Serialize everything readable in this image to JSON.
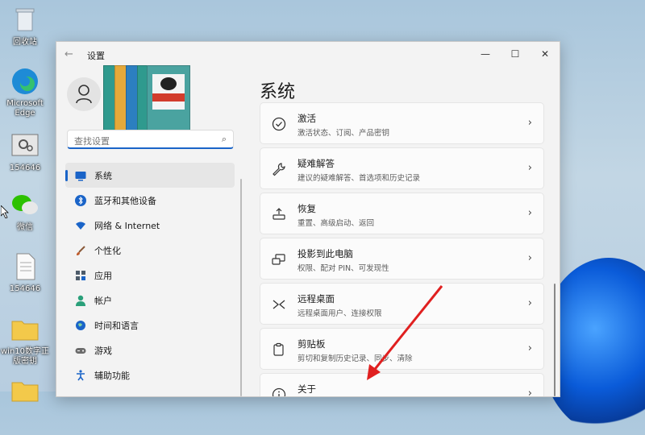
{
  "desktop": {
    "icons": [
      {
        "label": "回收站"
      },
      {
        "label": "Microsoft Edge"
      },
      {
        "label": "154646"
      },
      {
        "label": "微信"
      },
      {
        "label": "154646"
      },
      {
        "label": "win10数字正 版密钥"
      }
    ]
  },
  "window": {
    "title": "设置",
    "back": "←",
    "controls": {
      "minimize": "—",
      "maximize": "☐",
      "close": "✕"
    }
  },
  "sidebar": {
    "search_placeholder": "查找设置",
    "items": [
      {
        "label": "系统",
        "icon": "monitor-icon",
        "color": "#1a64c8"
      },
      {
        "label": "蓝牙和其他设备",
        "icon": "bluetooth-icon",
        "color": "#1a64c8"
      },
      {
        "label": "网络 & Internet",
        "icon": "wifi-icon",
        "color": "#1a64c8"
      },
      {
        "label": "个性化",
        "icon": "brush-icon",
        "color": "#c05a2a"
      },
      {
        "label": "应用",
        "icon": "apps-icon",
        "color": "#4d5b6a"
      },
      {
        "label": "帐户",
        "icon": "person-icon",
        "color": "#2aa07a"
      },
      {
        "label": "时间和语言",
        "icon": "globe-icon",
        "color": "#1a64c8"
      },
      {
        "label": "游戏",
        "icon": "gamepad-icon",
        "color": "#6b6b6b"
      },
      {
        "label": "辅助功能",
        "icon": "accessibility-icon",
        "color": "#1a64c8"
      }
    ]
  },
  "main": {
    "title": "系统",
    "cards": [
      {
        "title": "激活",
        "subtitle": "激活状态、订阅、产品密钥",
        "icon": "check-circle-icon"
      },
      {
        "title": "疑难解答",
        "subtitle": "建议的疑难解答、首选项和历史记录",
        "icon": "wrench-icon"
      },
      {
        "title": "恢复",
        "subtitle": "重置、高级启动、返回",
        "icon": "recovery-icon"
      },
      {
        "title": "投影到此电脑",
        "subtitle": "权限、配对 PIN、可发现性",
        "icon": "project-icon"
      },
      {
        "title": "远程桌面",
        "subtitle": "远程桌面用户、连接权限",
        "icon": "remote-icon"
      },
      {
        "title": "剪贴板",
        "subtitle": "剪切和复制历史记录、同步、清除",
        "icon": "clipboard-icon"
      },
      {
        "title": "关于",
        "subtitle": "",
        "icon": "info-icon"
      }
    ],
    "chevron": "›"
  },
  "colors": {
    "accent": "#1a64c8",
    "arrow": "#e02020"
  }
}
